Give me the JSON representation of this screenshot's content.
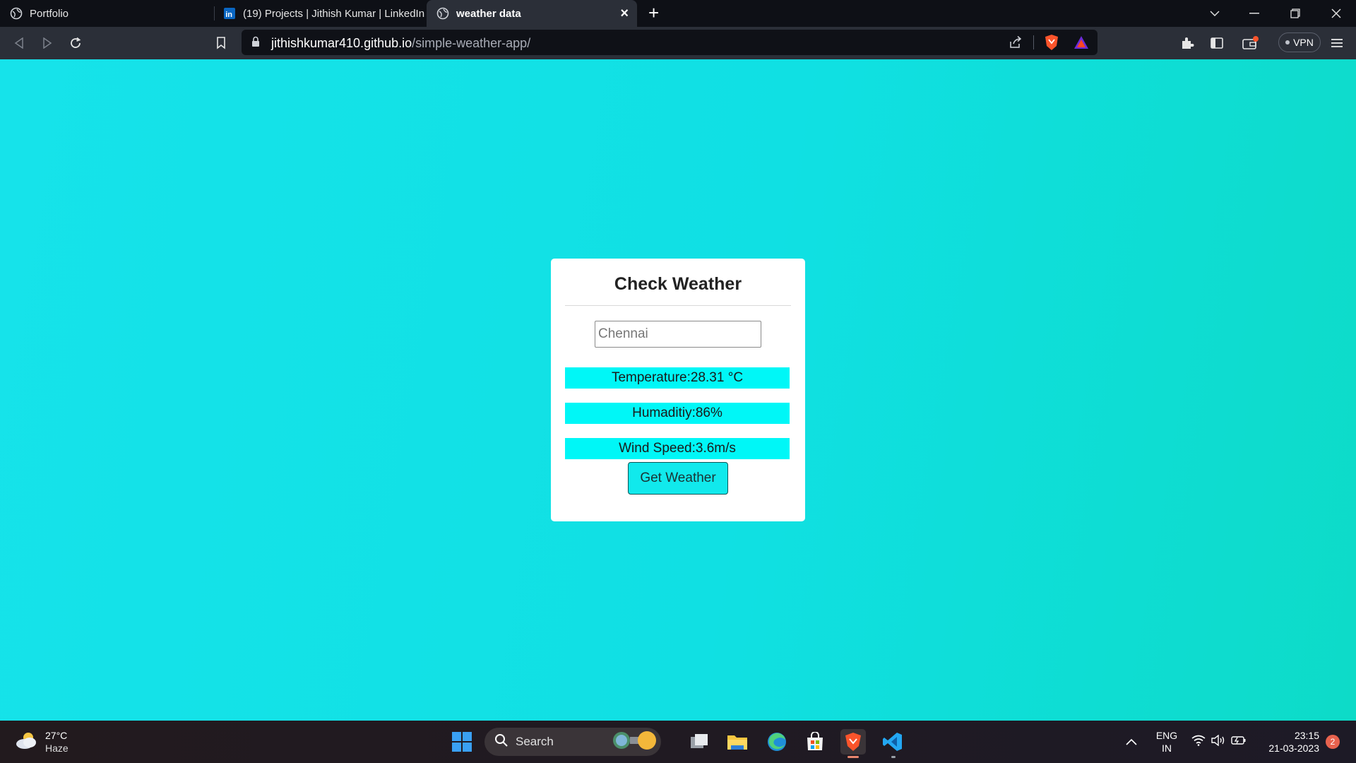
{
  "browser": {
    "tabs": [
      {
        "title": "Portfolio",
        "icon": "globe-icon"
      },
      {
        "title": "(19) Projects | Jithish Kumar | LinkedIn",
        "icon": "linkedin-icon"
      },
      {
        "title": "weather data",
        "icon": "globe-icon"
      }
    ],
    "url": {
      "host": "jithishkumar410.github.io",
      "path": "/simple-weather-app/"
    },
    "vpn_label": "VPN"
  },
  "app": {
    "title": "Check Weather",
    "city_input_value": "Chennai",
    "temperature": "Temperature:28.31 °C",
    "humidity": "Humaditiy:86%",
    "wind_speed": "Wind Speed:3.6m/s",
    "button_label": "Get Weather"
  },
  "taskbar": {
    "weather": {
      "temp": "27°C",
      "condition": "Haze"
    },
    "search_label": "Search",
    "language": {
      "lang": "ENG",
      "region": "IN"
    },
    "clock": {
      "time": "23:15",
      "date": "21-03-2023"
    },
    "notification_count": "2"
  },
  "colors": {
    "page_bg": "#13e4e6",
    "info_row_bg": "#00f7f7",
    "button_bg": "#11e9ec"
  }
}
